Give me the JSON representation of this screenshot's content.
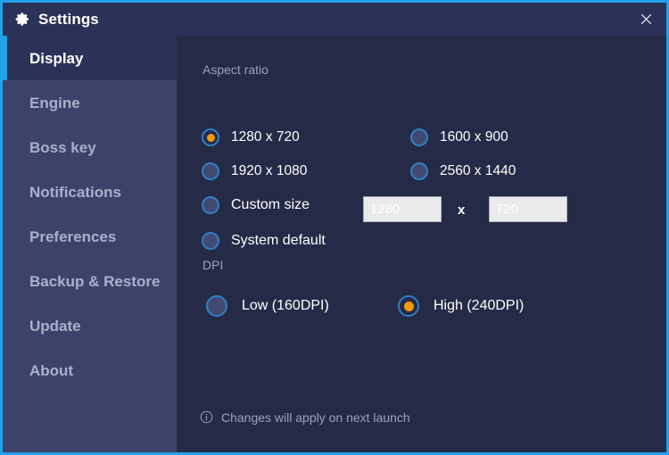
{
  "window": {
    "title": "Settings",
    "title_icon": "gear-icon",
    "close_icon": "close-icon",
    "accent_border_color": "#21a1e8",
    "titlebar_bg": "#2b3257",
    "content_bg": "#252b47",
    "sidebar_bg": "#3b436a"
  },
  "sidebar": {
    "items": [
      {
        "label": "Display",
        "active": true
      },
      {
        "label": "Engine",
        "active": false
      },
      {
        "label": "Boss key",
        "active": false
      },
      {
        "label": "Notifications",
        "active": false
      },
      {
        "label": "Preferences",
        "active": false
      },
      {
        "label": "Backup & Restore",
        "active": false
      },
      {
        "label": "Update",
        "active": false
      },
      {
        "label": "About",
        "active": false
      }
    ]
  },
  "main": {
    "aspect_ratio": {
      "section_label": "Aspect ratio",
      "options": [
        {
          "label": "1280 x 720",
          "selected": true
        },
        {
          "label": "1920 x 1080",
          "selected": false
        },
        {
          "label": "1600 x 900",
          "selected": false
        },
        {
          "label": "2560 x 1440",
          "selected": false
        },
        {
          "label": "Custom size",
          "selected": false
        },
        {
          "label": "System default",
          "selected": false
        }
      ],
      "custom_size": {
        "width_value": "",
        "width_placeholder": "1280",
        "separator": "x",
        "height_value": "",
        "height_placeholder": "720"
      }
    },
    "dpi": {
      "section_label": "DPI",
      "options": [
        {
          "label": "Low (160DPI)",
          "selected": false
        },
        {
          "label": "High (240DPI)",
          "selected": true
        }
      ]
    },
    "footer": {
      "icon": "info-icon",
      "text": "Changes will apply on next launch"
    }
  },
  "colors": {
    "radio_ring": "#2f7fc4",
    "radio_dot": "#f49a0b",
    "muted_text": "#9aa2c0",
    "nav_text": "#a9b0cc"
  }
}
